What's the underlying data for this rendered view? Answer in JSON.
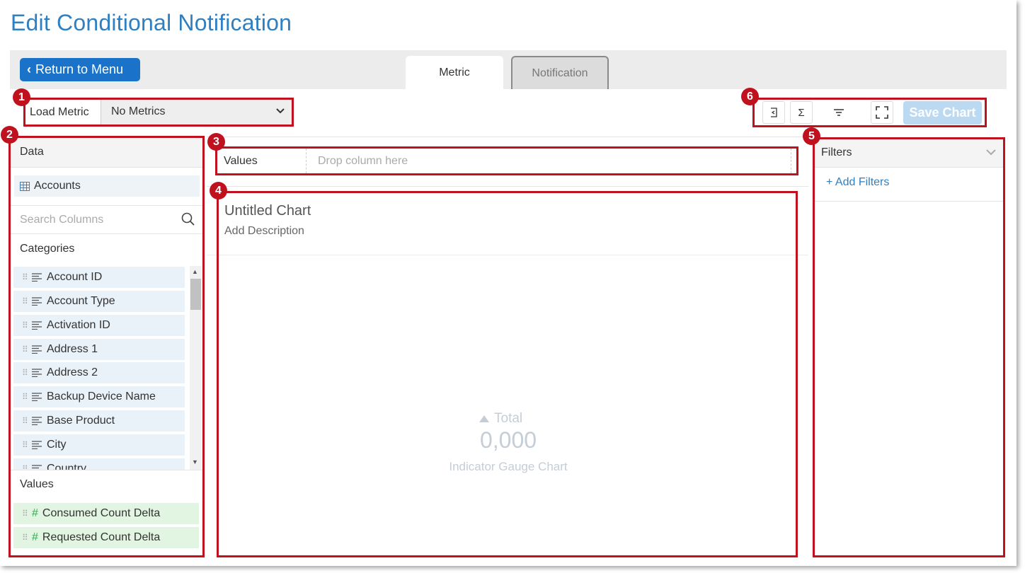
{
  "page": {
    "title": "Edit Conditional Notification"
  },
  "nav": {
    "return_label": "Return to Menu"
  },
  "tabs": [
    {
      "label": "Metric"
    },
    {
      "label": "Notification"
    }
  ],
  "load_metric": {
    "label": "Load Metric",
    "selected": "No Metrics"
  },
  "toolbar": {
    "save_label": "Save Chart",
    "sum_glyph": "Σ"
  },
  "badges": [
    "1",
    "2",
    "3",
    "4",
    "5",
    "6"
  ],
  "data_panel": {
    "header": "Data",
    "source": "Accounts",
    "search_placeholder": "Search Columns",
    "categories_title": "Categories",
    "categories": [
      "Account ID",
      "Account Type",
      "Activation ID",
      "Address 1",
      "Address 2",
      "Backup Device Name",
      "Base Product",
      "City",
      "Country"
    ],
    "values_title": "Values",
    "values": [
      "Consumed Count Delta",
      "Requested Count Delta"
    ]
  },
  "values_row": {
    "label": "Values",
    "placeholder": "Drop column here"
  },
  "chart": {
    "title": "Untitled Chart",
    "description": "Add Description",
    "gauge_total_label": "Total",
    "gauge_value": "0,000",
    "gauge_caption": "Indicator Gauge Chart"
  },
  "filters": {
    "header": "Filters",
    "add_label": "+ Add Filters"
  },
  "colors": {
    "accent": "#1a73c9",
    "annotation": "#c0111f",
    "title": "#2f7fc1"
  }
}
